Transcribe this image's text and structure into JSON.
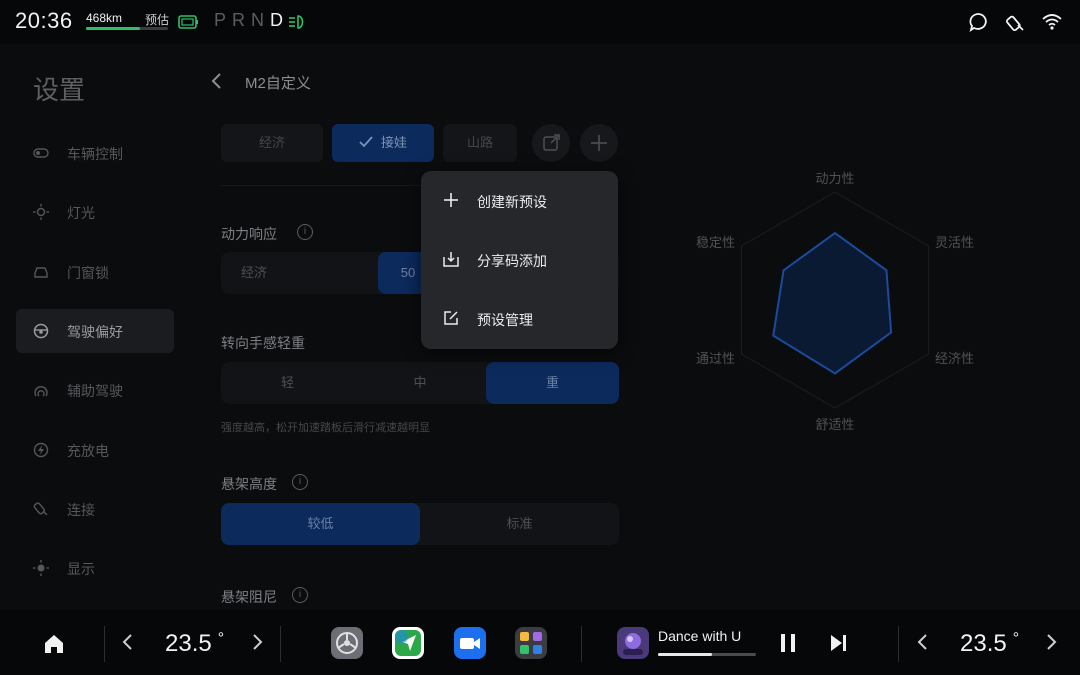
{
  "status": {
    "time": "20:36",
    "range": "468km",
    "estimate_label": "预估",
    "battery_level": 0.66,
    "gear": [
      "P",
      "R",
      "N",
      "D"
    ],
    "active_gear": "D"
  },
  "sidebar": {
    "title": "设置",
    "items": [
      {
        "label": "车辆控制",
        "icon": "toggle-icon"
      },
      {
        "label": "灯光",
        "icon": "sun-icon"
      },
      {
        "label": "门窗锁",
        "icon": "car-icon"
      },
      {
        "label": "驾驶偏好",
        "icon": "steering-wheel-icon",
        "active": true
      },
      {
        "label": "辅助驾驶",
        "icon": "assist-icon"
      },
      {
        "label": "充放电",
        "icon": "charge-icon"
      },
      {
        "label": "连接",
        "icon": "link-icon"
      },
      {
        "label": "显示",
        "icon": "brightness-icon"
      }
    ]
  },
  "main": {
    "title": "M2自定义",
    "modes": [
      "经济",
      "接娃",
      "山路"
    ],
    "selected_mode": "接娃",
    "power_response": {
      "label": "动力响应",
      "options": [
        "经济",
        "50"
      ]
    },
    "steering": {
      "label": "转向手感轻重",
      "options": [
        "轻",
        "中",
        "重"
      ],
      "selected": "重"
    },
    "hint": "强度越高，松开加速踏板后滑行减速越明显",
    "suspension_height": {
      "label": "悬架高度",
      "options": [
        "较低",
        "标准"
      ],
      "selected": "较低"
    },
    "suspension_damping": {
      "label": "悬架阻尼"
    }
  },
  "menu": {
    "items": [
      {
        "label": "创建新预设",
        "icon": "plus-icon"
      },
      {
        "label": "分享码添加",
        "icon": "download-icon"
      },
      {
        "label": "预设管理",
        "icon": "edit-icon"
      }
    ]
  },
  "radar": {
    "labels": [
      "动力性",
      "灵活性",
      "经济性",
      "舒适性",
      "通过性",
      "稳定性"
    ],
    "values": [
      0.62,
      0.55,
      0.6,
      0.68,
      0.66,
      0.55
    ]
  },
  "dock": {
    "temp_left": "23.5",
    "temp_right": "23.5",
    "degree": "°",
    "song_title": "Dance with U",
    "song_progress": 0.55,
    "apps": [
      "settings-app-icon",
      "navigation-app-icon",
      "video-app-icon",
      "apps-folder-icon"
    ]
  },
  "colors": {
    "accent": "#0c2a5c",
    "battery": "#2fbf6a"
  }
}
